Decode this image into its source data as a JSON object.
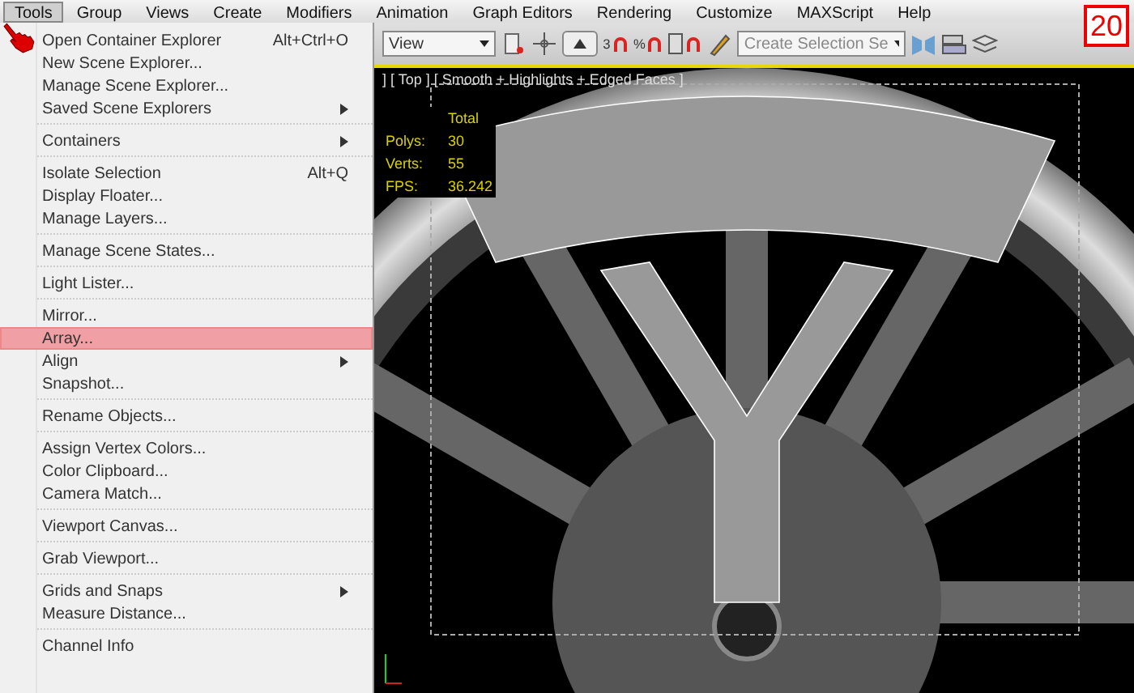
{
  "menu_bar": [
    {
      "label": "Tools",
      "selected": true
    },
    {
      "label": "Group",
      "selected": false
    },
    {
      "label": "Views",
      "selected": false
    },
    {
      "label": "Create",
      "selected": false
    },
    {
      "label": "Modifiers",
      "selected": false
    },
    {
      "label": "Animation",
      "selected": false
    },
    {
      "label": "Graph Editors",
      "selected": false
    },
    {
      "label": "Rendering",
      "selected": false
    },
    {
      "label": "Customize",
      "selected": false
    },
    {
      "label": "MAXScript",
      "selected": false
    },
    {
      "label": "Help",
      "selected": false
    }
  ],
  "toolbar": {
    "view_dropdown": "View",
    "snap_buttons": [
      {
        "label": "3"
      },
      {
        "label": "%"
      }
    ],
    "selection_set_dropdown": "Create Selection Se"
  },
  "step_badge": "20",
  "viewport": {
    "label": "] [ Top ] [ Smooth + Highlights + Edged Faces ]",
    "stats_heading": "Total",
    "stats": [
      {
        "label": "Polys:",
        "value": "30"
      },
      {
        "label": "Verts:",
        "value": "55"
      },
      {
        "label": "FPS:",
        "value": "36.242"
      }
    ]
  },
  "tools_menu": [
    {
      "kind": "item",
      "label": "Open Container Explorer",
      "shortcut": "Alt+Ctrl+O",
      "submenu": false,
      "selected": false
    },
    {
      "kind": "item",
      "label": "New Scene Explorer...",
      "submenu": false,
      "selected": false
    },
    {
      "kind": "item",
      "label": "Manage Scene Explorer...",
      "submenu": false,
      "selected": false
    },
    {
      "kind": "item",
      "label": "Saved Scene Explorers",
      "submenu": true,
      "selected": false
    },
    {
      "kind": "separator"
    },
    {
      "kind": "item",
      "label": "Containers",
      "submenu": true,
      "selected": false
    },
    {
      "kind": "separator"
    },
    {
      "kind": "item",
      "label": "Isolate Selection",
      "shortcut": "Alt+Q",
      "submenu": false,
      "selected": false
    },
    {
      "kind": "item",
      "label": "Display Floater...",
      "submenu": false,
      "selected": false
    },
    {
      "kind": "item",
      "label": "Manage Layers...",
      "submenu": false,
      "selected": false
    },
    {
      "kind": "separator"
    },
    {
      "kind": "item",
      "label": "Manage Scene States...",
      "submenu": false,
      "selected": false
    },
    {
      "kind": "separator"
    },
    {
      "kind": "item",
      "label": "Light Lister...",
      "submenu": false,
      "selected": false
    },
    {
      "kind": "separator"
    },
    {
      "kind": "item",
      "label": "Mirror...",
      "submenu": false,
      "selected": false
    },
    {
      "kind": "item",
      "label": "Array...",
      "submenu": false,
      "selected": true
    },
    {
      "kind": "item",
      "label": "Align",
      "submenu": true,
      "selected": false
    },
    {
      "kind": "item",
      "label": "Snapshot...",
      "submenu": false,
      "selected": false
    },
    {
      "kind": "separator"
    },
    {
      "kind": "item",
      "label": "Rename Objects...",
      "submenu": false,
      "selected": false
    },
    {
      "kind": "separator"
    },
    {
      "kind": "item",
      "label": "Assign Vertex Colors...",
      "submenu": false,
      "selected": false
    },
    {
      "kind": "item",
      "label": "Color Clipboard...",
      "submenu": false,
      "selected": false
    },
    {
      "kind": "item",
      "label": "Camera Match...",
      "submenu": false,
      "selected": false
    },
    {
      "kind": "separator"
    },
    {
      "kind": "item",
      "label": "Viewport Canvas...",
      "submenu": false,
      "selected": false
    },
    {
      "kind": "separator"
    },
    {
      "kind": "item",
      "label": "Grab Viewport...",
      "submenu": false,
      "selected": false
    },
    {
      "kind": "separator"
    },
    {
      "kind": "item",
      "label": "Grids and Snaps",
      "submenu": true,
      "selected": false
    },
    {
      "kind": "item",
      "label": "Measure Distance...",
      "submenu": false,
      "selected": false
    },
    {
      "kind": "separator"
    },
    {
      "kind": "item",
      "label": "Channel Info",
      "submenu": false,
      "selected": false
    }
  ]
}
